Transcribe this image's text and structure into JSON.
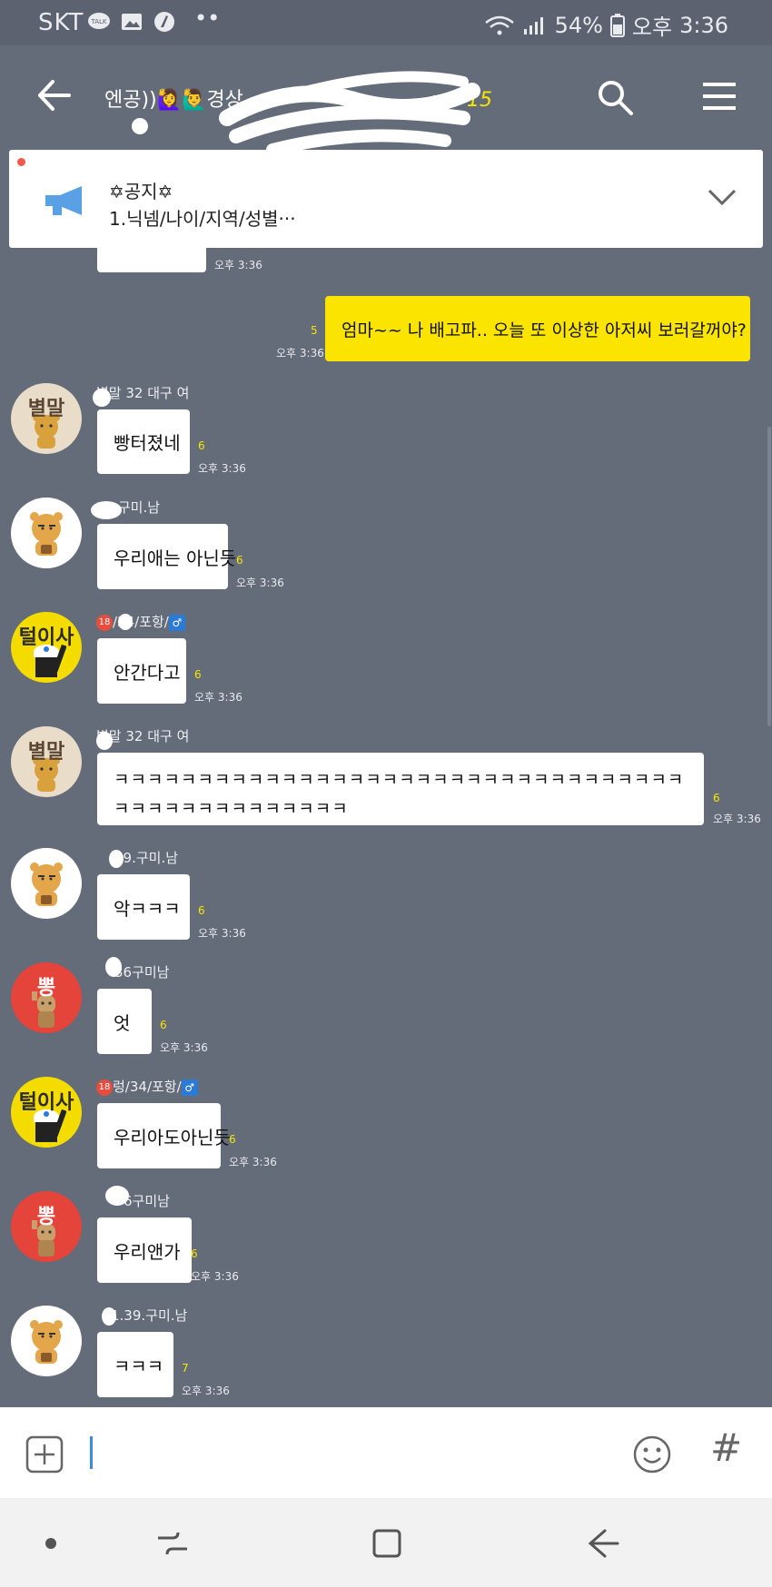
{
  "status": {
    "carrier": "SKT",
    "battery": "54%",
    "ampm": "오후",
    "clock": "3:36"
  },
  "header": {
    "title": "엔공))🙋‍♀️🙋‍♂️경상",
    "title_tail": "m?",
    "member_count": "15"
  },
  "notice": {
    "title": "✡공지✡",
    "text": "1.닉넴/나이/지역/성별···"
  },
  "messages": [
    {
      "type": "me",
      "text": "엄마~~ 나 배고파.. 오늘 또 이상한 아저씨 보러갈꺼야?",
      "unread": "5",
      "time": "오후 3:36"
    },
    {
      "sender": "별말 32 대구 여",
      "avatar": "별말",
      "text": "빵터졌네",
      "unread": "6",
      "time": "오후 3:36"
    },
    {
      "sender": "39.구미.남",
      "avatar": "",
      "text": "우리애는 아닌듯",
      "unread": "6",
      "time": "오후 3:36"
    },
    {
      "sender": "/34/포항/",
      "avatar": "털이사",
      "text": "안간다고",
      "unread": "6",
      "time": "오후 3:36"
    },
    {
      "sender": "별말 32 대구 여",
      "avatar": "별말",
      "text": "ㅋㅋㅋㅋㅋㅋㅋㅋㅋㅋㅋㅋㅋㅋㅋㅋㅋㅋㅋㅋㅋㅋㅋㅋㅋㅋㅋㅋㅋㅋㅋㅋㅋㅋㅋㅋㅋㅋㅋㅋㅋㅋㅋㅋㅋㅋㅋㅋ",
      "unread": "6",
      "time": "오후 3:36"
    },
    {
      "sender": "39.구미.남",
      "avatar": "",
      "text": "악ㅋㅋㅋ",
      "unread": "6",
      "time": "오후 3:36"
    },
    {
      "sender": "36구미남",
      "avatar": "뽕",
      "text": "엇",
      "unread": "6",
      "time": "오후 3:36"
    },
    {
      "sender": "렁/34/포항/",
      "avatar": "털이사",
      "text": "우리아도아닌듯",
      "unread": "6",
      "time": "오후 3:36"
    },
    {
      "sender": "6구미남",
      "avatar": "뽕",
      "text": "우리앤가",
      "unread": "6",
      "time": "오후 3:36"
    },
    {
      "sender": "1.39.구미.남",
      "avatar": "",
      "text": "ㅋㅋㅋ",
      "unread": "7",
      "time": "오후 3:36"
    }
  ],
  "input": {
    "placeholder": "",
    "hash": "#"
  },
  "icons": [
    "back-arrow-icon",
    "search-icon",
    "hamburger-menu-icon",
    "megaphone-icon",
    "chevron-down-icon",
    "plus-icon",
    "emoji-icon",
    "hashtag-icon"
  ],
  "colors": {
    "background": "#646b79",
    "my_bubble": "#fbe500",
    "unread": "#f7e600",
    "accent_cursor": "#3c8be0"
  }
}
